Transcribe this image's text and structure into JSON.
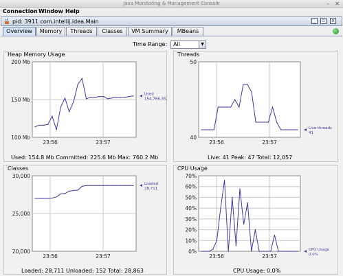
{
  "window": {
    "title": "Java Monitoring & Management Console"
  },
  "menubar": {
    "items": [
      "Connection",
      "Window",
      "Help"
    ]
  },
  "internal_frame": {
    "title": "pid: 3911 com.intellij.idea.Main"
  },
  "tabs": [
    "Overview",
    "Memory",
    "Threads",
    "Classes",
    "VM Summary",
    "MBeans"
  ],
  "active_tab": "Overview",
  "time_range": {
    "label": "Time Range:",
    "value": "All"
  },
  "panels": {
    "heap": {
      "title": "Heap Memory Usage",
      "summary": "Used: 154.8 Mb    Committed: 225.6 Mb    Max: 760.2 Mb",
      "marker_label_1": "Used",
      "marker_label_2": "154,766,352"
    },
    "threads": {
      "title": "Threads",
      "summary": "Live: 41    Peak: 47    Total: 12,057",
      "marker_label_1": "Live threads",
      "marker_label_2": "41"
    },
    "classes": {
      "title": "Classes",
      "summary": "Loaded: 28,711    Unloaded: 152    Total: 28,863",
      "marker_label_1": "Loaded",
      "marker_label_2": "28,711"
    },
    "cpu": {
      "title": "CPU Usage",
      "summary": "CPU Usage: 0.0%",
      "marker_label_1": "CPU Usage",
      "marker_label_2": "0.0%"
    }
  },
  "colors": {
    "line": "#3b3ba0",
    "grid": "#c8c8c8",
    "plot_bg": "#ffffff"
  },
  "chart_data": [
    {
      "type": "line",
      "title": "Heap Memory Usage",
      "y_ticks": [
        "200 Mb",
        "150 Mb",
        "100 Mb"
      ],
      "ylim": [
        100,
        200
      ],
      "x_ticks": [
        "23:56",
        "23:57"
      ],
      "series": [
        {
          "name": "Used",
          "values": [
            114,
            116,
            116,
            117,
            128,
            110,
            140,
            152,
            134,
            147,
            170,
            178,
            151,
            153,
            153,
            154,
            154,
            151,
            152,
            153,
            153,
            153,
            154,
            154.8
          ]
        }
      ]
    },
    {
      "type": "line",
      "title": "Threads",
      "y_ticks": [
        "50",
        "40"
      ],
      "ylim": [
        40,
        50
      ],
      "x_ticks": [
        "23:56",
        "23:57"
      ],
      "series": [
        {
          "name": "Live threads",
          "values": [
            41,
            41,
            41,
            41,
            44,
            44,
            44,
            44,
            45,
            44,
            47,
            47,
            46,
            42,
            42,
            42,
            42,
            44,
            42,
            41,
            41,
            41,
            41,
            41
          ]
        }
      ]
    },
    {
      "type": "line",
      "title": "Classes",
      "y_ticks": [
        "30,000",
        "25,000",
        "20,000"
      ],
      "ylim": [
        20000,
        30000
      ],
      "x_ticks": [
        "23:56",
        "23:57"
      ],
      "series": [
        {
          "name": "Loaded",
          "values": [
            27000,
            27000,
            27000,
            27000,
            27050,
            27200,
            27600,
            27650,
            27950,
            28050,
            28100,
            28600,
            28711,
            28711,
            28711,
            28711,
            28711,
            28711,
            28711,
            28711,
            28711,
            28711,
            28711,
            28711
          ]
        }
      ]
    },
    {
      "type": "line",
      "title": "CPU Usage",
      "y_ticks": [
        "70%",
        "60%",
        "50%",
        "40%",
        "30%",
        "20%",
        "10%",
        "0%"
      ],
      "ylim": [
        0,
        70
      ],
      "x_ticks": [
        "23:56",
        "23:57"
      ],
      "series": [
        {
          "name": "CPU Usage",
          "values": [
            0,
            0,
            0,
            2,
            10,
            40,
            66,
            0,
            50,
            5,
            58,
            25,
            45,
            0,
            20,
            0,
            0,
            0,
            0,
            15,
            0,
            0,
            0,
            0,
            0,
            0.0
          ]
        }
      ]
    }
  ]
}
